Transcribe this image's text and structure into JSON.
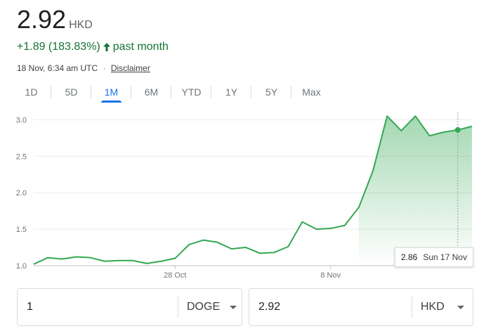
{
  "header": {
    "price": "2.92",
    "currency": "HKD",
    "change": "+1.89 (183.83%)",
    "period": "past month",
    "timestamp": "18 Nov, 6:34 am UTC",
    "separator": "·",
    "disclaimer": "Disclaimer"
  },
  "tabs": [
    {
      "label": "1D",
      "active": false
    },
    {
      "label": "5D",
      "active": false
    },
    {
      "label": "1M",
      "active": true
    },
    {
      "label": "6M",
      "active": false
    },
    {
      "label": "YTD",
      "active": false
    },
    {
      "label": "1Y",
      "active": false
    },
    {
      "label": "5Y",
      "active": false
    },
    {
      "label": "Max",
      "active": false
    }
  ],
  "tooltip": {
    "value": "2.86",
    "date": "Sun 17 Nov"
  },
  "converter": {
    "from_amount": "1",
    "from_currency": "DOGE",
    "to_amount": "2.92",
    "to_currency": "HKD"
  },
  "colors": {
    "line": "#34a853",
    "positive": "#137333",
    "accent": "#1a73e8"
  },
  "icons": {
    "change_direction": "arrow-up-icon",
    "dropdown": "caret-down-icon"
  },
  "chart_data": {
    "type": "area",
    "x": [
      "2024-10-18",
      "2024-10-19",
      "2024-10-20",
      "2024-10-21",
      "2024-10-22",
      "2024-10-23",
      "2024-10-24",
      "2024-10-25",
      "2024-10-26",
      "2024-10-27",
      "2024-10-28",
      "2024-10-29",
      "2024-10-30",
      "2024-10-31",
      "2024-11-01",
      "2024-11-02",
      "2024-11-03",
      "2024-11-04",
      "2024-11-05",
      "2024-11-06",
      "2024-11-07",
      "2024-11-08",
      "2024-11-09",
      "2024-11-10",
      "2024-11-11",
      "2024-11-12",
      "2024-11-13",
      "2024-11-14",
      "2024-11-15",
      "2024-11-16",
      "2024-11-17",
      "2024-11-18"
    ],
    "series": [
      {
        "values": [
          1.02,
          1.11,
          1.09,
          1.12,
          1.11,
          1.06,
          1.07,
          1.07,
          1.03,
          1.06,
          1.1,
          1.29,
          1.35,
          1.32,
          1.23,
          1.25,
          1.17,
          1.18,
          1.26,
          1.6,
          1.5,
          1.51,
          1.55,
          1.8,
          2.3,
          3.05,
          2.85,
          3.05,
          2.78,
          2.83,
          2.86,
          2.91
        ]
      }
    ],
    "ylim": [
      1.0,
      3.1
    ],
    "yticks": [
      "3.0",
      "2.5",
      "2.0",
      "1.5",
      "1.0"
    ],
    "xticks": [
      {
        "label": "28 Oct",
        "x": "2024-10-28"
      },
      {
        "label": "8 Nov",
        "x": "2024-11-08"
      }
    ],
    "highlight_x": "2024-11-17",
    "grid": true
  }
}
